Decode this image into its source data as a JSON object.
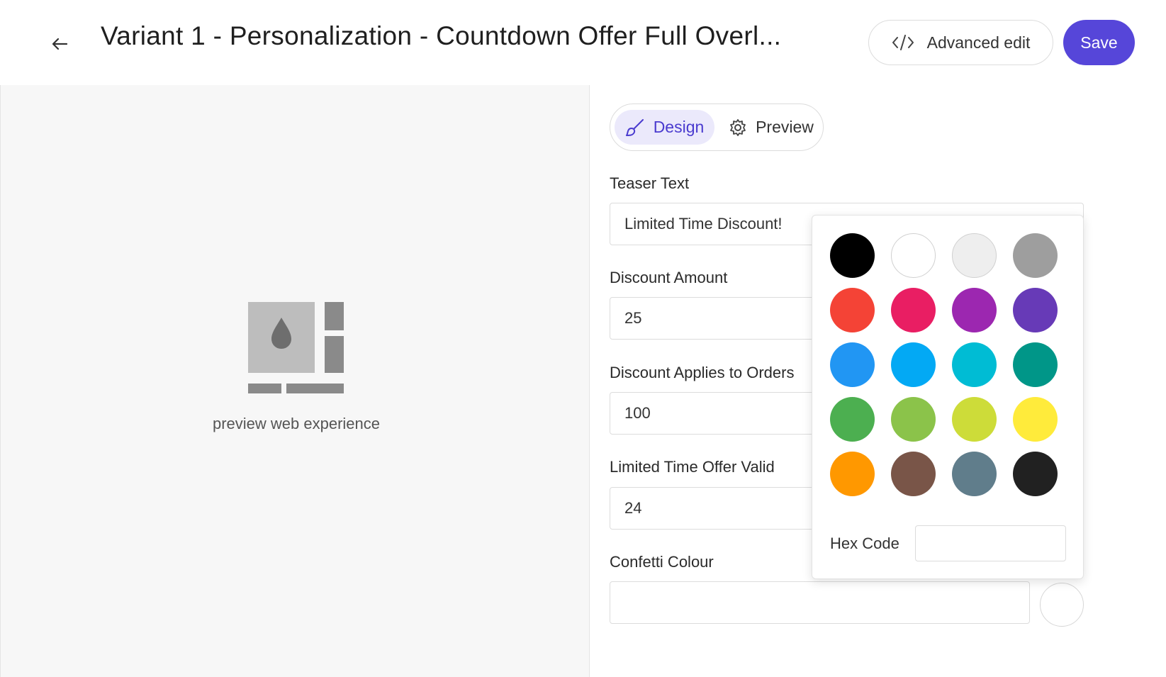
{
  "header": {
    "title": "Variant 1 - Personalization - Countdown Offer Full Overl...",
    "advanced_edit_label": "Advanced edit",
    "save_label": "Save"
  },
  "left_panel": {
    "preview_text": "preview web experience"
  },
  "tabs": {
    "design_label": "Design",
    "preview_label": "Preview",
    "active": "Design"
  },
  "form": {
    "teaser_text": {
      "label": "Teaser Text",
      "value": "Limited Time Discount!"
    },
    "discount_amount": {
      "label": "Discount Amount",
      "value": "25"
    },
    "discount_applies": {
      "label": "Discount Applies to Orders",
      "value": "100"
    },
    "offer_valid": {
      "label": "Limited Time Offer Valid",
      "value": "24"
    },
    "confetti_colour": {
      "label": "Confetti Colour",
      "value": ""
    }
  },
  "color_picker": {
    "hex_label": "Hex Code",
    "hex_value": "",
    "swatches": [
      "#000000",
      "#ffffff",
      "#eeeeee",
      "#9e9e9e",
      "#f44336",
      "#e91e63",
      "#9c27b0",
      "#673ab7",
      "#2196f3",
      "#03a9f4",
      "#00bcd4",
      "#009688",
      "#4caf50",
      "#8bc34a",
      "#cddc39",
      "#ffeb3b",
      "#ff9800",
      "#795548",
      "#607d8b",
      "#212121"
    ]
  },
  "colors": {
    "accent": "#5646d9",
    "tab_active_bg": "#ebe9fb"
  }
}
